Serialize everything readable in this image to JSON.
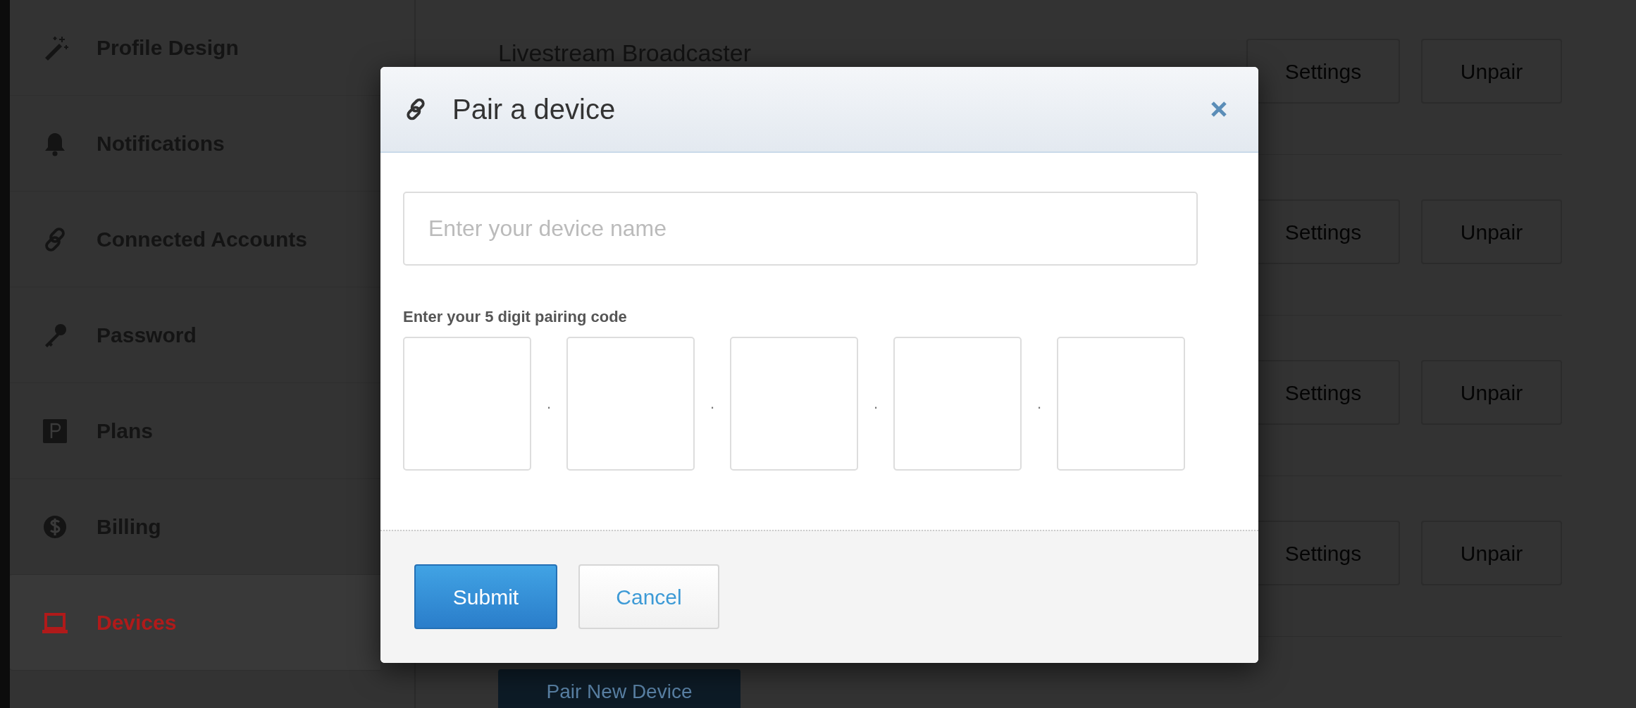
{
  "sidebar": {
    "items": [
      {
        "label": "Profile Design",
        "selected": false
      },
      {
        "label": "Notifications",
        "selected": false
      },
      {
        "label": "Connected Accounts",
        "selected": false
      },
      {
        "label": "Password",
        "selected": false
      },
      {
        "label": "Plans",
        "selected": false
      },
      {
        "label": "Billing",
        "selected": false
      },
      {
        "label": "Devices",
        "selected": true
      }
    ]
  },
  "devices": [
    {
      "name": "Livestream Broadcaster",
      "buttons": [
        "Settings",
        "Unpair"
      ]
    },
    {
      "buttons": [
        "Settings",
        "Unpair"
      ]
    },
    {
      "buttons": [
        "Settings",
        "Unpair"
      ]
    },
    {
      "buttons": [
        "Settings",
        "Unpair"
      ]
    }
  ],
  "pair_button": "Pair New Device",
  "modal": {
    "title": "Pair a device",
    "device_name": {
      "placeholder": "Enter your device name"
    },
    "code_label": "Enter your 5 digit pairing code",
    "code_fields": [
      {
        "kind": "digit"
      },
      {
        "kind": "separator",
        "text": "."
      },
      {
        "kind": "digit"
      },
      {
        "kind": "separator",
        "text": "."
      },
      {
        "kind": "digit"
      },
      {
        "kind": "separator",
        "text": "."
      },
      {
        "kind": "digit"
      },
      {
        "kind": "separator",
        "text": "."
      },
      {
        "kind": "digit"
      }
    ],
    "buttons": [
      {
        "label": "Submit",
        "kind": "primary"
      },
      {
        "label": "Cancel",
        "kind": "default"
      }
    ]
  }
}
